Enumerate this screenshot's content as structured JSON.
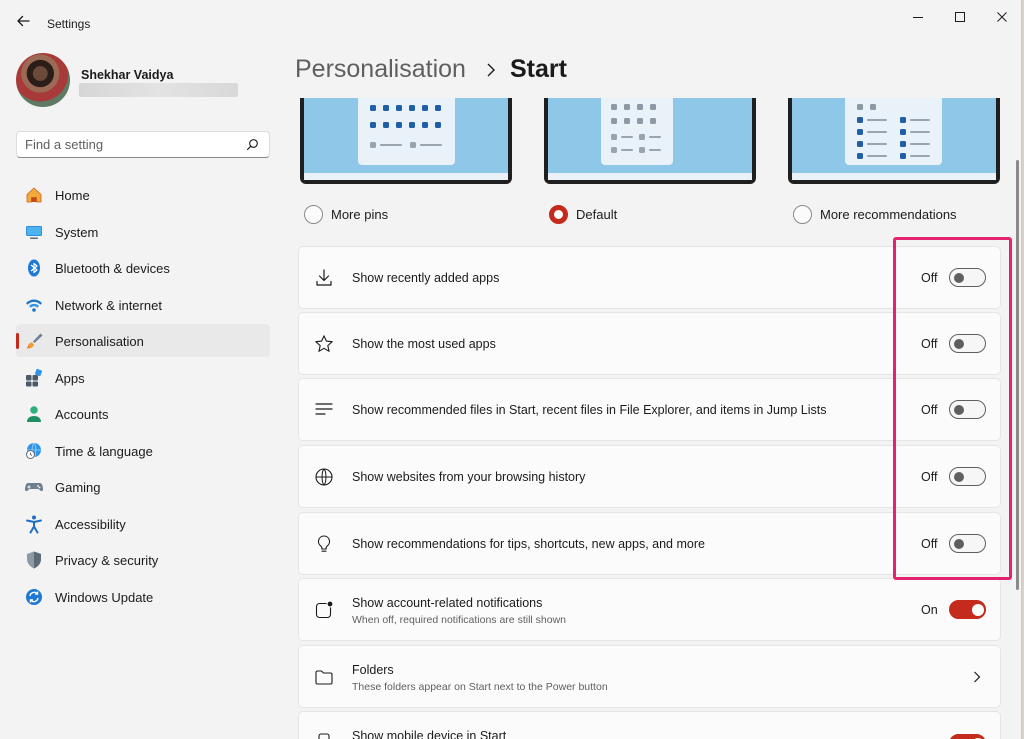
{
  "window": {
    "title": "Settings",
    "controls": [
      "minimize-icon",
      "maximize-icon",
      "close-icon"
    ]
  },
  "user": {
    "name": "Shekhar Vaidya"
  },
  "search": {
    "placeholder": "Find a setting"
  },
  "sidebar": {
    "items": [
      {
        "label": "Home",
        "icon": "home-icon"
      },
      {
        "label": "System",
        "icon": "monitor-icon"
      },
      {
        "label": "Bluetooth & devices",
        "icon": "bluetooth-icon"
      },
      {
        "label": "Network & internet",
        "icon": "wifi-icon"
      },
      {
        "label": "Personalisation",
        "icon": "brush-icon",
        "active": true
      },
      {
        "label": "Apps",
        "icon": "apps-icon"
      },
      {
        "label": "Accounts",
        "icon": "person-icon"
      },
      {
        "label": "Time & language",
        "icon": "globe-clock-icon"
      },
      {
        "label": "Gaming",
        "icon": "gamepad-icon"
      },
      {
        "label": "Accessibility",
        "icon": "accessibility-icon"
      },
      {
        "label": "Privacy & security",
        "icon": "shield-icon"
      },
      {
        "label": "Windows Update",
        "icon": "update-icon"
      }
    ]
  },
  "breadcrumb": {
    "parent": "Personalisation",
    "current": "Start"
  },
  "layout_options": [
    {
      "label": "More pins",
      "selected": false
    },
    {
      "label": "Default",
      "selected": true
    },
    {
      "label": "More recommendations",
      "selected": false
    }
  ],
  "settings": [
    {
      "title": "Show recently added apps",
      "state": "Off",
      "icon": "download-icon"
    },
    {
      "title": "Show the most used apps",
      "state": "Off",
      "icon": "star-icon"
    },
    {
      "title": "Show recommended files in Start, recent files in File Explorer, and items in Jump Lists",
      "state": "Off",
      "icon": "list-icon"
    },
    {
      "title": "Show websites from your browsing history",
      "state": "Off",
      "icon": "globe-icon"
    },
    {
      "title": "Show recommendations for tips, shortcuts, new apps, and more",
      "state": "Off",
      "icon": "lightbulb-icon"
    },
    {
      "title": "Show account-related notifications",
      "subtitle": "When off, required notifications are still shown",
      "state": "On",
      "icon": "notification-icon"
    },
    {
      "title": "Folders",
      "subtitle": "These folders appear on Start next to the Power button",
      "icon": "folder-icon"
    },
    {
      "title": "Show mobile device in Start",
      "icon": "phone-icon"
    }
  ],
  "colors": {
    "accent": "#c42b1c",
    "highlight": "#e2246f"
  }
}
